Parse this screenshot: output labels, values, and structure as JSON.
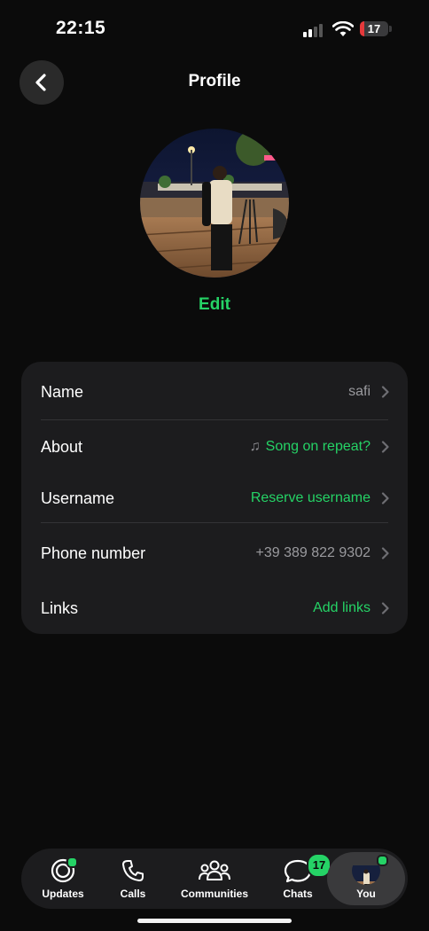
{
  "status_bar": {
    "time": "22:15",
    "battery": "17",
    "battery_level": 0.17
  },
  "header": {
    "title": "Profile",
    "back_icon": "chevron-left-icon"
  },
  "profile": {
    "edit_label": "Edit"
  },
  "rows": [
    {
      "label": "Name",
      "value": "safi",
      "value_color": "gray"
    },
    {
      "label": "About",
      "value": "Song on repeat?",
      "value_color": "green",
      "icon": "music-note-icon"
    },
    {
      "label": "Username",
      "value": "Reserve username",
      "value_color": "green"
    },
    {
      "label": "Phone number",
      "value": "+39 389 822 9302",
      "value_color": "gray"
    },
    {
      "label": "Links",
      "value": "Add links",
      "value_color": "green"
    }
  ],
  "tabs": [
    {
      "label": "Updates",
      "icon": "updates-icon"
    },
    {
      "label": "Calls",
      "icon": "phone-icon"
    },
    {
      "label": "Communities",
      "icon": "communities-icon"
    },
    {
      "label": "Chats",
      "icon": "chats-icon",
      "badge": "17"
    },
    {
      "label": "You",
      "icon": "avatar"
    }
  ],
  "colors": {
    "accent": "#25d366",
    "background": "#0b0b0b",
    "card": "#1c1c1e",
    "battery_low": "#e5393b"
  }
}
